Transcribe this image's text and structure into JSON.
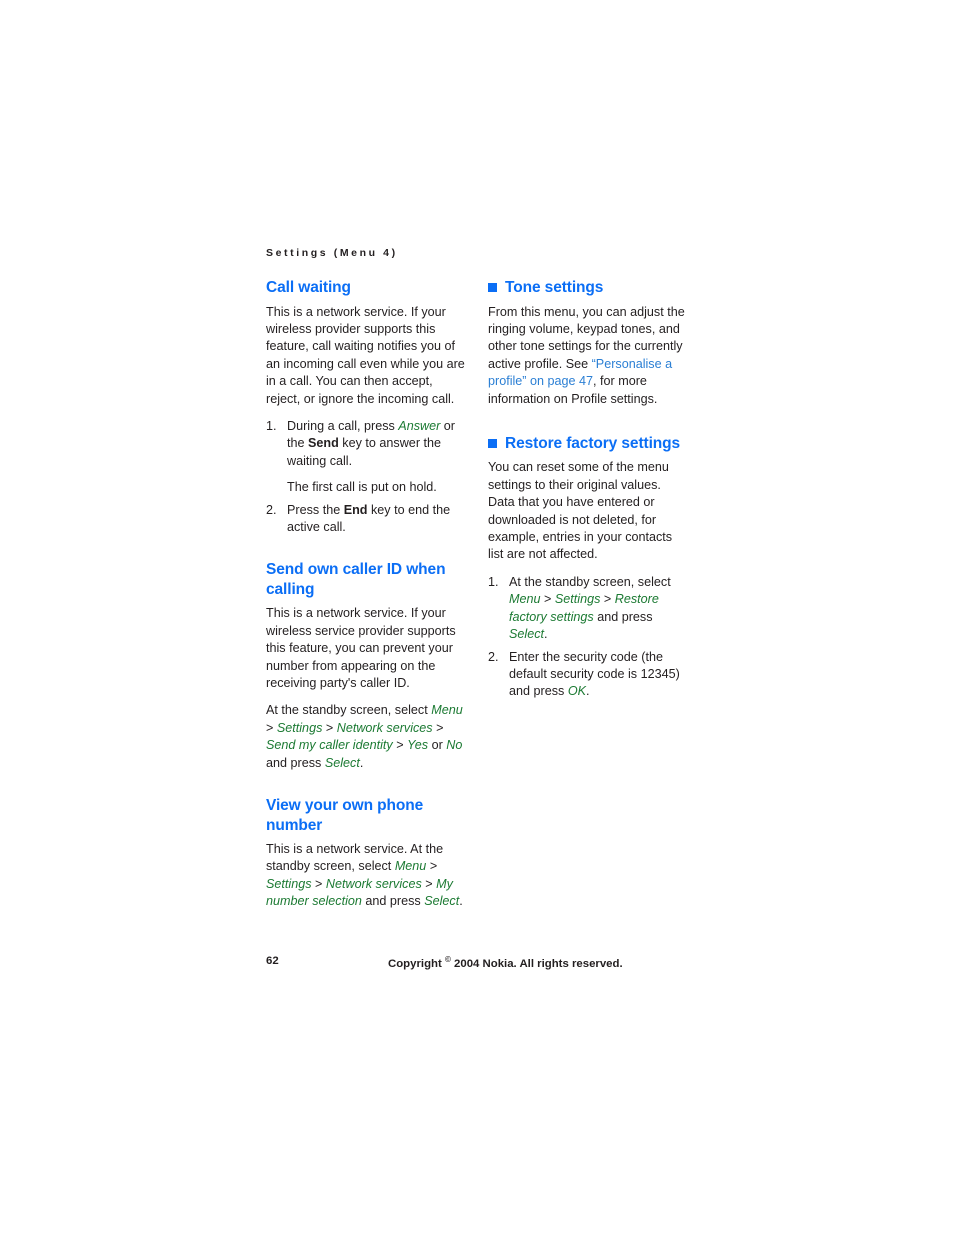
{
  "document": {
    "running_header": "Settings (Menu 4)",
    "page_number": "62",
    "copyright": "Copyright ",
    "copyright_symbol": "©",
    "copyright_rest": " 2004 Nokia. All rights reserved."
  },
  "colors": {
    "heading_blue": "#0b6ef5",
    "crossref_blue": "#2b7fd4",
    "menu_green": "#1c7a33",
    "body_black": "#231f20"
  },
  "left_column": {
    "call_waiting": {
      "heading": "Call waiting",
      "paragraph": "This is a network service. If your wireless provider supports this feature, call waiting notifies you of an incoming call even while you are in a call. You can then accept, reject, or ignore the incoming call.",
      "steps": [
        {
          "number": "1.",
          "parts": [
            {
              "text": "During a call, press ",
              "style": "plain"
            },
            {
              "text": "Answer",
              "style": "green-italic"
            },
            {
              "text": " or the ",
              "style": "plain"
            },
            {
              "text": "Send",
              "style": "bold"
            },
            {
              "text": " key to answer the waiting call.",
              "style": "plain"
            }
          ],
          "follow_up": "The first call is put on hold."
        },
        {
          "number": "2.",
          "parts": [
            {
              "text": "Press the ",
              "style": "plain"
            },
            {
              "text": "End",
              "style": "bold"
            },
            {
              "text": " key to end the active call.",
              "style": "plain"
            }
          ]
        }
      ]
    },
    "send_own_caller_id": {
      "heading": "Send own caller ID when calling",
      "paragraph": "This is a network service. If your wireless service provider supports this feature, you can prevent your number from appearing on the receiving party's caller ID.",
      "path_parts": [
        {
          "text": "At the standby screen, select ",
          "style": "plain"
        },
        {
          "text": "Menu",
          "style": "green-italic"
        },
        {
          "text": " > ",
          "style": "plain"
        },
        {
          "text": "Settings",
          "style": "green-italic"
        },
        {
          "text": " > ",
          "style": "plain"
        },
        {
          "text": "Network services",
          "style": "green-italic"
        },
        {
          "text": " > ",
          "style": "plain"
        },
        {
          "text": "Send my caller identity",
          "style": "green-italic"
        },
        {
          "text": " > ",
          "style": "plain"
        },
        {
          "text": "Yes",
          "style": "green-italic"
        },
        {
          "text": " or ",
          "style": "plain"
        },
        {
          "text": "No",
          "style": "green-italic"
        },
        {
          "text": " and press ",
          "style": "plain"
        },
        {
          "text": "Select",
          "style": "green-italic"
        },
        {
          "text": ".",
          "style": "plain"
        }
      ]
    },
    "view_own_phone_number": {
      "heading": "View your own phone number",
      "path_parts": [
        {
          "text": "This is a network service. At the standby screen, select ",
          "style": "plain"
        },
        {
          "text": "Menu",
          "style": "green-italic"
        },
        {
          "text": " > ",
          "style": "plain"
        },
        {
          "text": "Settings",
          "style": "green-italic"
        },
        {
          "text": " > ",
          "style": "plain"
        },
        {
          "text": "Network services",
          "style": "green-italic"
        },
        {
          "text": " > ",
          "style": "plain"
        },
        {
          "text": "My number selection",
          "style": "green-italic"
        },
        {
          "text": " and press ",
          "style": "plain"
        },
        {
          "text": "Select",
          "style": "green-italic"
        },
        {
          "text": ".",
          "style": "plain"
        }
      ]
    }
  },
  "right_column": {
    "tone_settings": {
      "heading": "Tone settings",
      "bullet": "blue-square-bullet",
      "parts": [
        {
          "text": "From this menu, you can adjust the ringing volume, keypad tones, and other tone settings for the currently active profile. See ",
          "style": "plain"
        },
        {
          "text": "“Personalise a profile” on page 47",
          "style": "crossref"
        },
        {
          "text": ", for more information on Profile settings.",
          "style": "plain"
        }
      ]
    },
    "restore_factory_settings": {
      "heading": "Restore factory settings",
      "bullet": "blue-square-bullet",
      "paragraph": "You can reset some of the menu settings to their original values. Data that you have entered or downloaded is not deleted, for example, entries in your contacts list are not affected.",
      "steps": [
        {
          "number": "1.",
          "parts": [
            {
              "text": "At the standby screen, select ",
              "style": "plain"
            },
            {
              "text": "Menu",
              "style": "green-italic"
            },
            {
              "text": " > ",
              "style": "plain"
            },
            {
              "text": "Settings",
              "style": "green-italic"
            },
            {
              "text": " > ",
              "style": "plain"
            },
            {
              "text": "Restore factory settings",
              "style": "green-italic"
            },
            {
              "text": " and press ",
              "style": "plain"
            },
            {
              "text": "Select",
              "style": "green-italic"
            },
            {
              "text": ".",
              "style": "plain"
            }
          ]
        },
        {
          "number": "2.",
          "parts": [
            {
              "text": "Enter the security code (the default security code is 12345) and press ",
              "style": "plain"
            },
            {
              "text": "OK",
              "style": "green-italic"
            },
            {
              "text": ".",
              "style": "plain"
            }
          ]
        }
      ]
    }
  }
}
